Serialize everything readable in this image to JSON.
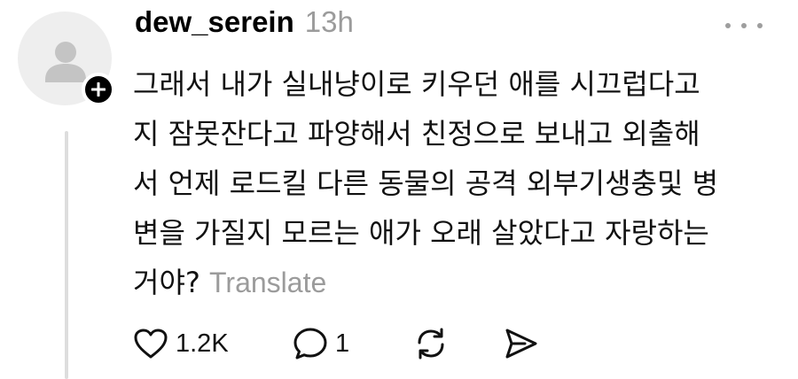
{
  "post": {
    "username": "dew_serein",
    "timestamp": "13h",
    "text_lines": [
      "그래서 내가 실내냥이로 키우던 애를 시끄럽다고",
      "지 잠못잔다고 파양해서 친정으로 보내고 외출해",
      "서 언제 로드킬 다른 동물의 공격 외부기생충및 병",
      "변을 가질지 모르는 애가 오래 살았다고 자랑하는"
    ],
    "last_line_text": "거야?",
    "translate_label": "Translate"
  },
  "actions": {
    "like_count": "1.2K",
    "reply_count": "1"
  },
  "icons": {
    "avatar": "default-user-icon",
    "follow": "plus-icon",
    "more": "more-dots-icon",
    "like": "heart-icon",
    "reply": "comment-bubble-icon",
    "repost": "repost-icon",
    "share": "send-icon"
  }
}
